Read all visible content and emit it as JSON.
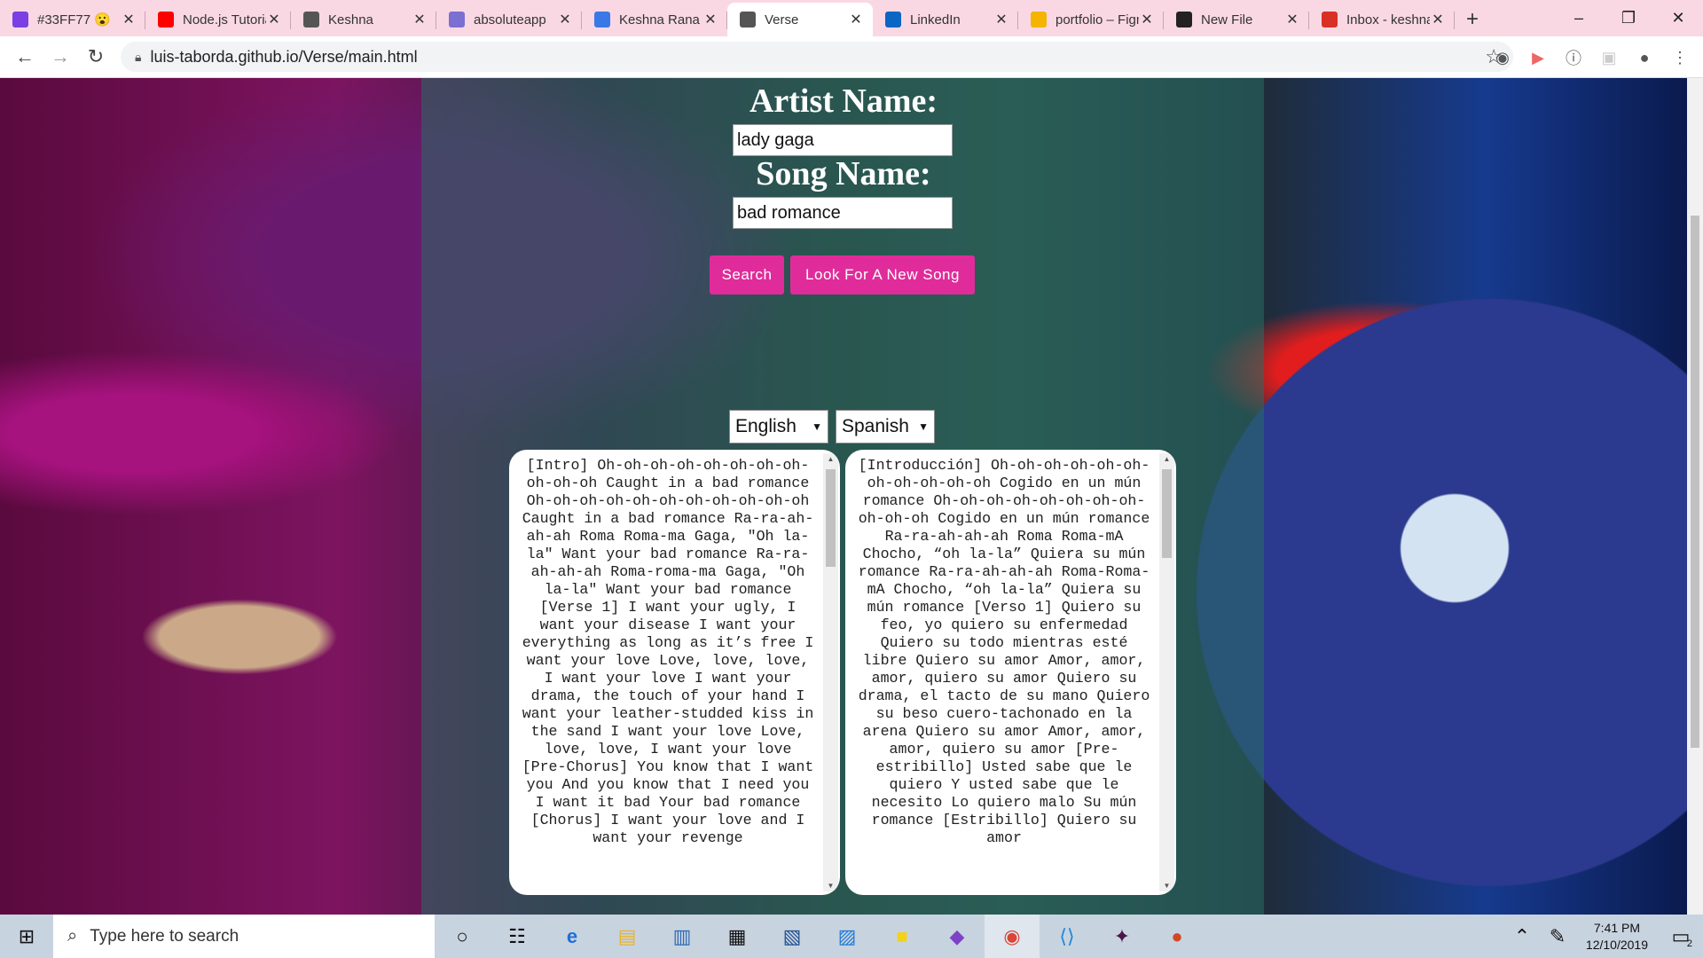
{
  "browser": {
    "tabs": [
      {
        "title": "#33FF77 😮",
        "favicon": "color-wheel-icon",
        "fav_color": "#7b3fe4"
      },
      {
        "title": "Node.js Tutorial",
        "favicon": "youtube-icon",
        "fav_color": "#ff0000"
      },
      {
        "title": "Keshna",
        "favicon": "globe-icon",
        "fav_color": "#555555"
      },
      {
        "title": "absoluteapp",
        "favicon": "hackmd-icon",
        "fav_color": "#7b6fd1"
      },
      {
        "title": "Keshna Rana",
        "favicon": "docs-icon",
        "fav_color": "#3b78e7"
      },
      {
        "title": "Verse",
        "favicon": "globe-icon",
        "fav_color": "#555555",
        "active": true
      },
      {
        "title": "LinkedIn",
        "favicon": "linkedin-icon",
        "fav_color": "#0a66c2"
      },
      {
        "title": "portfolio – Figma",
        "favicon": "figma-icon",
        "fav_color": "#f4b400"
      },
      {
        "title": "New File",
        "favicon": "github-icon",
        "fav_color": "#222222"
      },
      {
        "title": "Inbox - keshna",
        "favicon": "gmail-icon",
        "fav_color": "#d93025"
      }
    ],
    "url": "luis-taborda.github.io/Verse/main.html"
  },
  "page": {
    "artist_label": "Artist Name:",
    "artist_value": "lady gaga",
    "song_label": "Song Name:",
    "song_value": "bad romance",
    "search_button": "Search",
    "new_song_button": "Look For A New Song",
    "source_language": "English",
    "target_language": "Spanish",
    "original_lyrics": "[Intro] Oh-oh-oh-oh-oh-oh-oh-oh-oh-oh-oh Caught in a bad romance Oh-oh-oh-oh-oh-oh-oh-oh-oh-oh-oh Caught in a bad romance Ra-ra-ah-ah-ah Roma Roma-ma Gaga, \"Oh la-la\" Want your bad romance Ra-ra-ah-ah-ah Roma-roma-ma Gaga, \"Oh la-la\" Want your bad romance [Verse 1] I want your ugly, I want your disease I want your everything as long as it’s free I want your love Love, love, love, I want your love I want your drama, the touch of your hand I want your leather-studded kiss in the sand I want your love Love, love, love, I want your love [Pre-Chorus] You know that I want you And you know that I need you I want it bad Your bad romance [Chorus] I want your love and I want your revenge",
    "translated_lyrics": "[Introducción] Oh-oh-oh-oh-oh-oh-oh-oh-oh-oh-oh Cogido en un mún romance Oh-oh-oh-oh-oh-oh-oh-oh-oh-oh-oh Cogido en un mún romance Ra-ra-ah-ah-ah Roma Roma-mA Chocho, “oh la-la” Quiera su mún romance Ra-ra-ah-ah-ah Roma-Roma-mA Chocho, “oh la-la” Quiera su mún romance [Verso 1] Quiero su feo, yo quiero su enfermedad Quiero su todo mientras esté libre Quiero su amor Amor, amor, amor, quiero su amor Quiero su drama, el tacto de su mano Quiero su beso cuero-tachonado en la arena Quiero su amor Amor, amor, amor, quiero su amor [Pre-estribillo] Usted sabe que le quiero Y usted sabe que le necesito Lo quiero malo Su mún romance [Estribillo] Quiero su amor"
  },
  "taskbar": {
    "search_placeholder": "Type here to search",
    "time": "7:41 PM",
    "date": "12/10/2019",
    "notification_count": "2"
  }
}
